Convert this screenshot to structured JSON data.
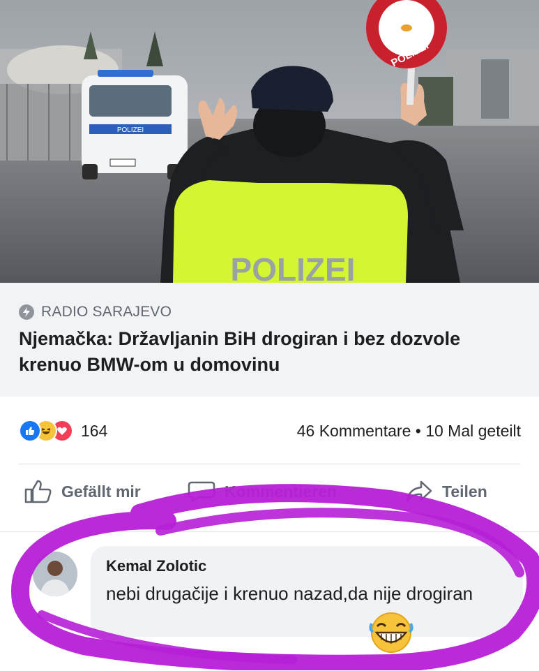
{
  "photo": {
    "sign_text": "POLIZEI",
    "van_text": "POLIZEI",
    "vest_text": "POLIZEI"
  },
  "link": {
    "source": "RADIO SARAJEVO",
    "headline": "Njemačka: Državljanin BiH drogiran i bez dozvole krenuo BMW-om u domovinu"
  },
  "post": {
    "reaction_count": "164",
    "comment_share": "46 Kommentare • 10 Mal geteilt",
    "actions": {
      "like": "Gefällt mir",
      "comment": "Kommentieren",
      "share": "Teilen"
    }
  },
  "comment": {
    "author": "Kemal Zolotic",
    "text": "nebi drugačije i krenuo nazad,da nije drogiran",
    "emoji": "laughing-emoji"
  },
  "colors": {
    "scribble": "#b61fd6",
    "vest": "#d4f532",
    "like_blue": "#1877f2"
  }
}
